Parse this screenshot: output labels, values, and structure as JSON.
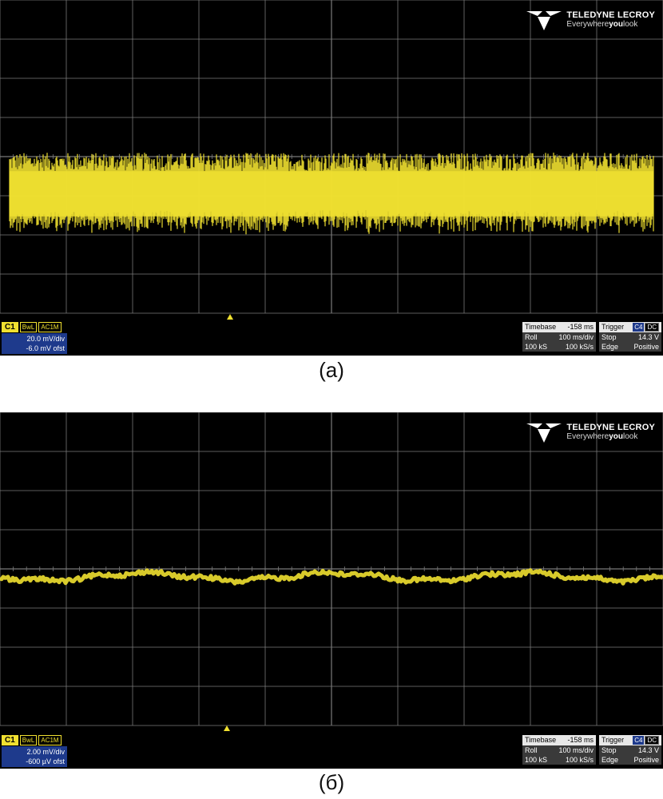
{
  "brand": {
    "name": "TELEDYNE LECROY",
    "tagline_pre": "Everywhere",
    "tagline_bold": "you",
    "tagline_post": "look"
  },
  "colors": {
    "trace": "#f0e030",
    "grid": "#7a7a7a",
    "channel_value_bg": "#1e3a8c",
    "screen": "#000000"
  },
  "panels": [
    {
      "caption": "(а)",
      "channel": {
        "name": "C1",
        "flag1": "BwL",
        "flag2": "AC1M",
        "scale": "20.0 mV/div",
        "offset": "-6.0 mV ofst"
      },
      "timebase": {
        "label": "Timebase",
        "value": "-158 ms",
        "mode": "Roll",
        "per_div": "100 ms/div",
        "samples": "100 kS",
        "rate": "100 kS/s"
      },
      "trigger": {
        "label": "Trigger",
        "source": "C4",
        "coupling": "DC",
        "state": "Stop",
        "level": "14.3 V",
        "type": "Edge",
        "slope": "Positive"
      },
      "trace_style": {
        "center_div": 4.95,
        "amplitude_div": 1.05
      }
    },
    {
      "caption": "(б)",
      "channel": {
        "name": "C1",
        "flag1": "BwL",
        "flag2": "AC1M",
        "scale": "2.00 mV/div",
        "offset": "-600 µV ofst"
      },
      "timebase": {
        "label": "Timebase",
        "value": "-158 ms",
        "mode": "Roll",
        "per_div": "100 ms/div",
        "samples": "100 kS",
        "rate": "100 kS/s"
      },
      "trigger": {
        "label": "Trigger",
        "source": "C4",
        "coupling": "DC",
        "state": "Stop",
        "level": "14.3 V",
        "type": "Edge",
        "slope": "Positive"
      },
      "trace_style": {
        "center_div": 4.2,
        "amplitude_div": 0.12
      }
    }
  ]
}
